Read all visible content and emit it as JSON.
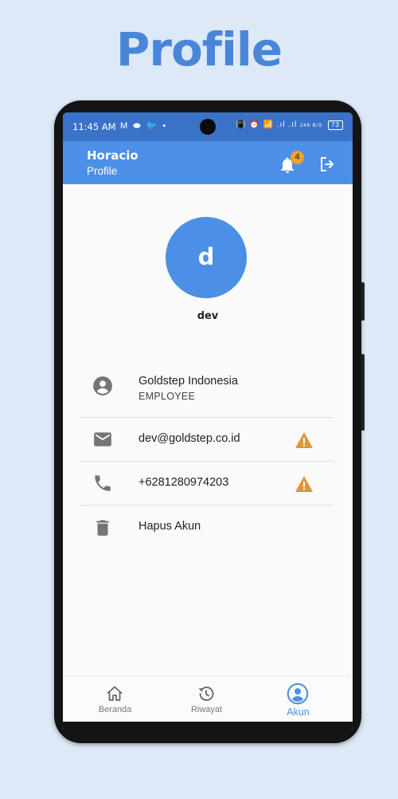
{
  "header": {
    "title": "Profile"
  },
  "status_bar": {
    "time": "11:45 AM",
    "left_icons": "M ⬬ 🐦 •",
    "right_icons": "📳 ⏰ 📶 .ıl .ıl",
    "network_speed": "246 B/S",
    "battery": "73"
  },
  "appbar": {
    "title": "Horacio",
    "subtitle": "Profile",
    "notification_count": "4",
    "accent": "#4c8fe6",
    "badge_color": "#f0a12a"
  },
  "profile": {
    "avatar_letter": "d",
    "username": "dev",
    "company": "Goldstep Indonesia",
    "role": "EMPLOYEE",
    "email": "dev@goldstep.co.id",
    "phone": "+6281280974203",
    "delete_label": "Hapus Akun",
    "warning_color": "#e0963a"
  },
  "bottom_nav": {
    "items": [
      {
        "label": "Beranda",
        "icon": "home-icon",
        "active": false
      },
      {
        "label": "Riwayat",
        "icon": "history-icon",
        "active": false
      },
      {
        "label": "Akun",
        "icon": "account-icon",
        "active": true
      }
    ]
  }
}
